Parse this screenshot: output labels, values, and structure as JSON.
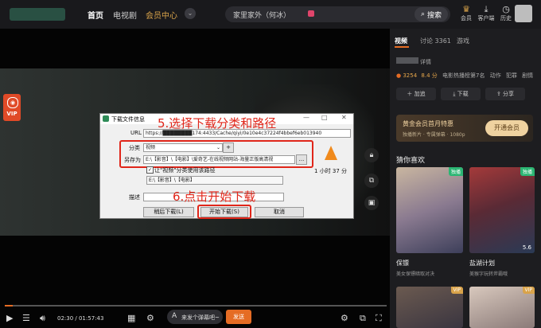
{
  "nav": {
    "home": "首页",
    "tv": "电视剧",
    "member": "会员中心"
  },
  "search": {
    "value": "家里家外（何冰）",
    "button": "搜索"
  },
  "top_icons": [
    {
      "label": "会员",
      "icon": "crown-icon"
    },
    {
      "label": "客户端",
      "icon": "download-icon"
    },
    {
      "label": "历史",
      "icon": "clock-icon"
    }
  ],
  "player": {
    "vip_label": "VIP",
    "time": "02:30 / 01:57:43",
    "danmu_placeholder": "来发个弹幕吧~",
    "send_label": "发送",
    "progress": 0.02
  },
  "dialog": {
    "title": "下载文件信息",
    "url_label": "URL",
    "url_value": "https://████████174:4433/Cache/qiyi/0e10e4c37224f4bbef6eb013940",
    "category_label": "分类",
    "category_value": "视频",
    "save_label": "另存为",
    "save_value": "E:\\【影音】\\【电影】\\爱奇艺-在线视频网站-海量正版高清视",
    "checkbox_label": "让\"视频\"分类使用该路径",
    "path_value": "E:\\【影音】\\【电影】",
    "desc_label": "描述",
    "later_label": "稍后下载(L)",
    "start_label": "开始下载(S)",
    "cancel_label": "取消",
    "duration": "1 小时 37 分",
    "plus": "+",
    "browse": "..."
  },
  "annotations": {
    "step5": "5.选择下载分类和路径",
    "step6": "6.点击开始下载"
  },
  "panel": {
    "tabs": [
      "视频",
      "讨论 3361",
      "游戏"
    ],
    "title_suffix": "详情",
    "stats": {
      "heat": "3254",
      "score": "8.4 分",
      "rank": "电影热播榜第7名",
      "tags": [
        "动作",
        "犯罪",
        "剧情"
      ]
    },
    "actions": [
      "加追",
      "下载",
      "分享"
    ],
    "promo": {
      "title": "黄金会员首月特惠",
      "sub": "独播新片 · 专属弹幕 · 1080p",
      "button": "开通会员"
    },
    "recommend_title": "猜你喜欢",
    "items": [
      {
        "title": "保镖",
        "desc": "美女保镖暗取对决",
        "badge": "独播"
      },
      {
        "title": "盐湖计划",
        "desc": "美猴字玩转斧霸哦",
        "badge": "独播",
        "score": "5.6"
      },
      {
        "badge": "VIP"
      },
      {
        "badge": "VIP"
      }
    ]
  },
  "colors": {
    "accent": "#e56c24",
    "annotation": "#e0261a",
    "gold": "#d9a34a"
  }
}
